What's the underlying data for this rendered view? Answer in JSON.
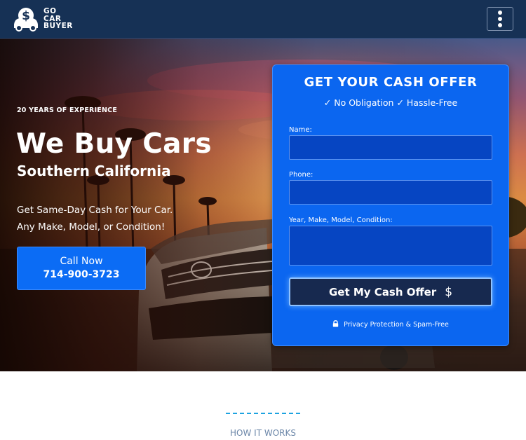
{
  "header": {
    "logo_lines": [
      "GO",
      "CAR",
      "BUYER"
    ],
    "menu_icon": "kebab-menu-icon"
  },
  "hero": {
    "eyebrow": "20 YEARS OF EXPERIENCE",
    "title": "We Buy Cars",
    "subtitle": "Southern California",
    "lead_line1": "Get Same-Day Cash for Your Car.",
    "lead_line2": "Any Make, Model, or Condition!",
    "call_label": "Call Now",
    "call_phone": "714-900-3723"
  },
  "form": {
    "title": "GET YOUR CASH OFFER",
    "subtitle": "✓ No Obligation ✓ Hassle-Free",
    "name_label": "Name:",
    "name_value": "",
    "phone_label": "Phone:",
    "phone_value": "",
    "vehicle_label": "Year, Make, Model, Condition:",
    "vehicle_value": "",
    "submit_label": "Get My Cash Offer",
    "submit_icon": "dollar-icon",
    "privacy_icon": "lock-icon",
    "privacy_text": "Privacy Protection & Spam-Free"
  },
  "section": {
    "label": "HOW IT WORKS"
  },
  "colors": {
    "header_bg": "#163155",
    "accent_blue": "#0b66f0",
    "button_dark": "#17294f",
    "divider": "#1ea3e0"
  }
}
